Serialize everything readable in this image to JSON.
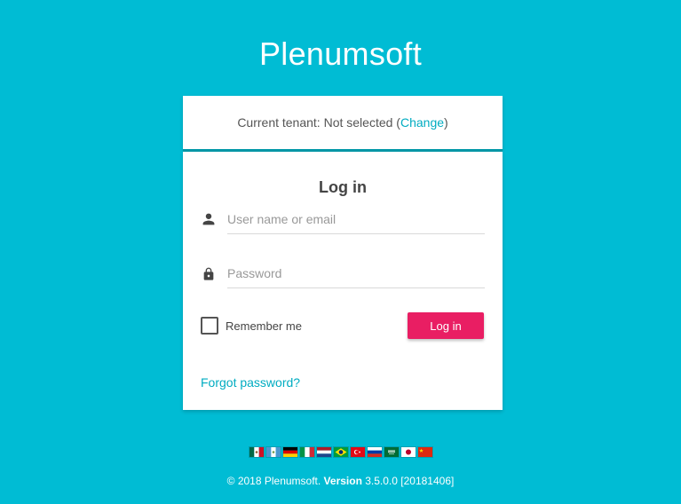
{
  "app": {
    "title": "Plenumsoft"
  },
  "tenant": {
    "prefix": "Current tenant: Not selected (",
    "change_link": "Change",
    "suffix": ")"
  },
  "login": {
    "heading": "Log in",
    "username_placeholder": "User name or email",
    "password_placeholder": "Password",
    "remember_label": "Remember me",
    "remember_checked": false,
    "submit_label": "Log in",
    "forgot_link": "Forgot password?"
  },
  "languages": [
    {
      "name": "mexico-flag-icon"
    },
    {
      "name": "guatemala-flag-icon"
    },
    {
      "name": "germany-flag-icon"
    },
    {
      "name": "italy-flag-icon"
    },
    {
      "name": "netherlands-flag-icon"
    },
    {
      "name": "brazil-flag-icon"
    },
    {
      "name": "turkey-flag-icon"
    },
    {
      "name": "russia-flag-icon"
    },
    {
      "name": "saudi-arabia-flag-icon"
    },
    {
      "name": "japan-flag-icon"
    },
    {
      "name": "china-flag-icon"
    }
  ],
  "footer": {
    "copyright": "© 2018 Plenumsoft. ",
    "version_label": "Version",
    "version_value": " 3.5.0.0 [20181406]"
  },
  "colors": {
    "background": "#00bcd4",
    "accent_link": "#00acc1",
    "divider": "#0097a7",
    "primary_button": "#e91e63"
  }
}
